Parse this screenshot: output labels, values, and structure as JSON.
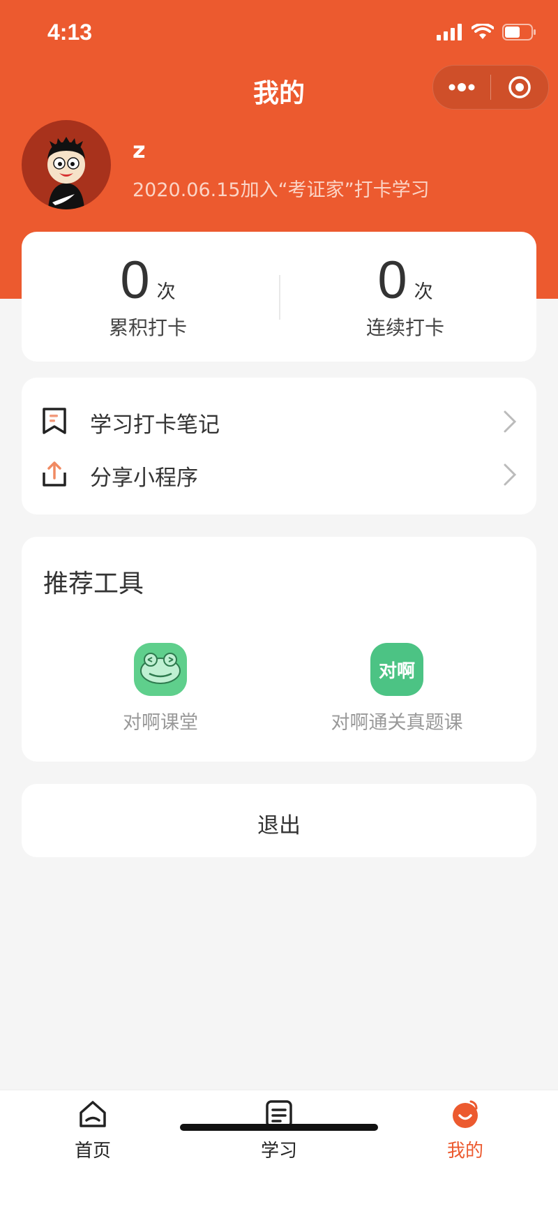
{
  "status_bar": {
    "time": "4:13"
  },
  "nav": {
    "title": "我的"
  },
  "profile": {
    "username": "z",
    "join_text": "2020.06.15加入“考证家”打卡学习"
  },
  "stats": [
    {
      "value": "0",
      "unit": "次",
      "label": "累积打卡"
    },
    {
      "value": "0",
      "unit": "次",
      "label": "连续打卡"
    }
  ],
  "menu": [
    {
      "label": "学习打卡笔记",
      "icon": "bookmark-note-icon"
    },
    {
      "label": "分享小程序",
      "icon": "share-upload-icon"
    }
  ],
  "tools": {
    "title": "推荐工具",
    "items": [
      {
        "label": "对啊课堂",
        "icon": "frog-icon",
        "color": "#5fcf8c"
      },
      {
        "label": "对啊通关真题课",
        "icon": "duia-logo-icon",
        "icon_text": "对啊",
        "color": "#4cc384"
      }
    ]
  },
  "logout": {
    "label": "退出"
  },
  "tabbar": {
    "tabs": [
      {
        "label": "首页",
        "icon": "home-icon",
        "active": false
      },
      {
        "label": "学习",
        "icon": "study-list-icon",
        "active": false
      },
      {
        "label": "我的",
        "icon": "smile-face-icon",
        "active": true
      }
    ],
    "active_color": "#ec5a2f"
  },
  "colors": {
    "brand": "#ec5a2f",
    "background": "#f5f5f5"
  }
}
